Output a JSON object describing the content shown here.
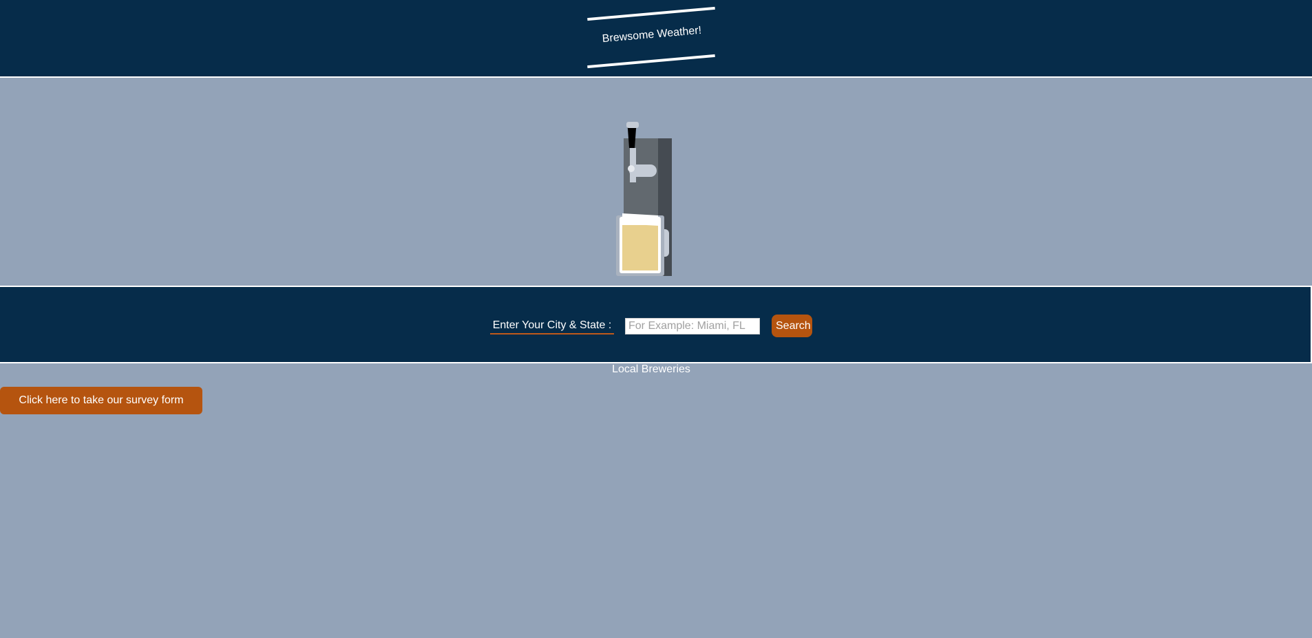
{
  "header": {
    "logo_text": "Brewsome Weather!"
  },
  "hero": {
    "illustration": "beer-tap-icon"
  },
  "search": {
    "label": "Enter Your City & State :",
    "placeholder": "For Example: Miami, FL",
    "value": "",
    "button_label": "Search"
  },
  "breweries": {
    "heading": "Local Breweries"
  },
  "survey": {
    "button_label": "Click here to take our survey form"
  },
  "colors": {
    "navy": "#062c4a",
    "background": "#93a3b8",
    "accent": "#b5540f",
    "beer": "#e8d08e"
  }
}
